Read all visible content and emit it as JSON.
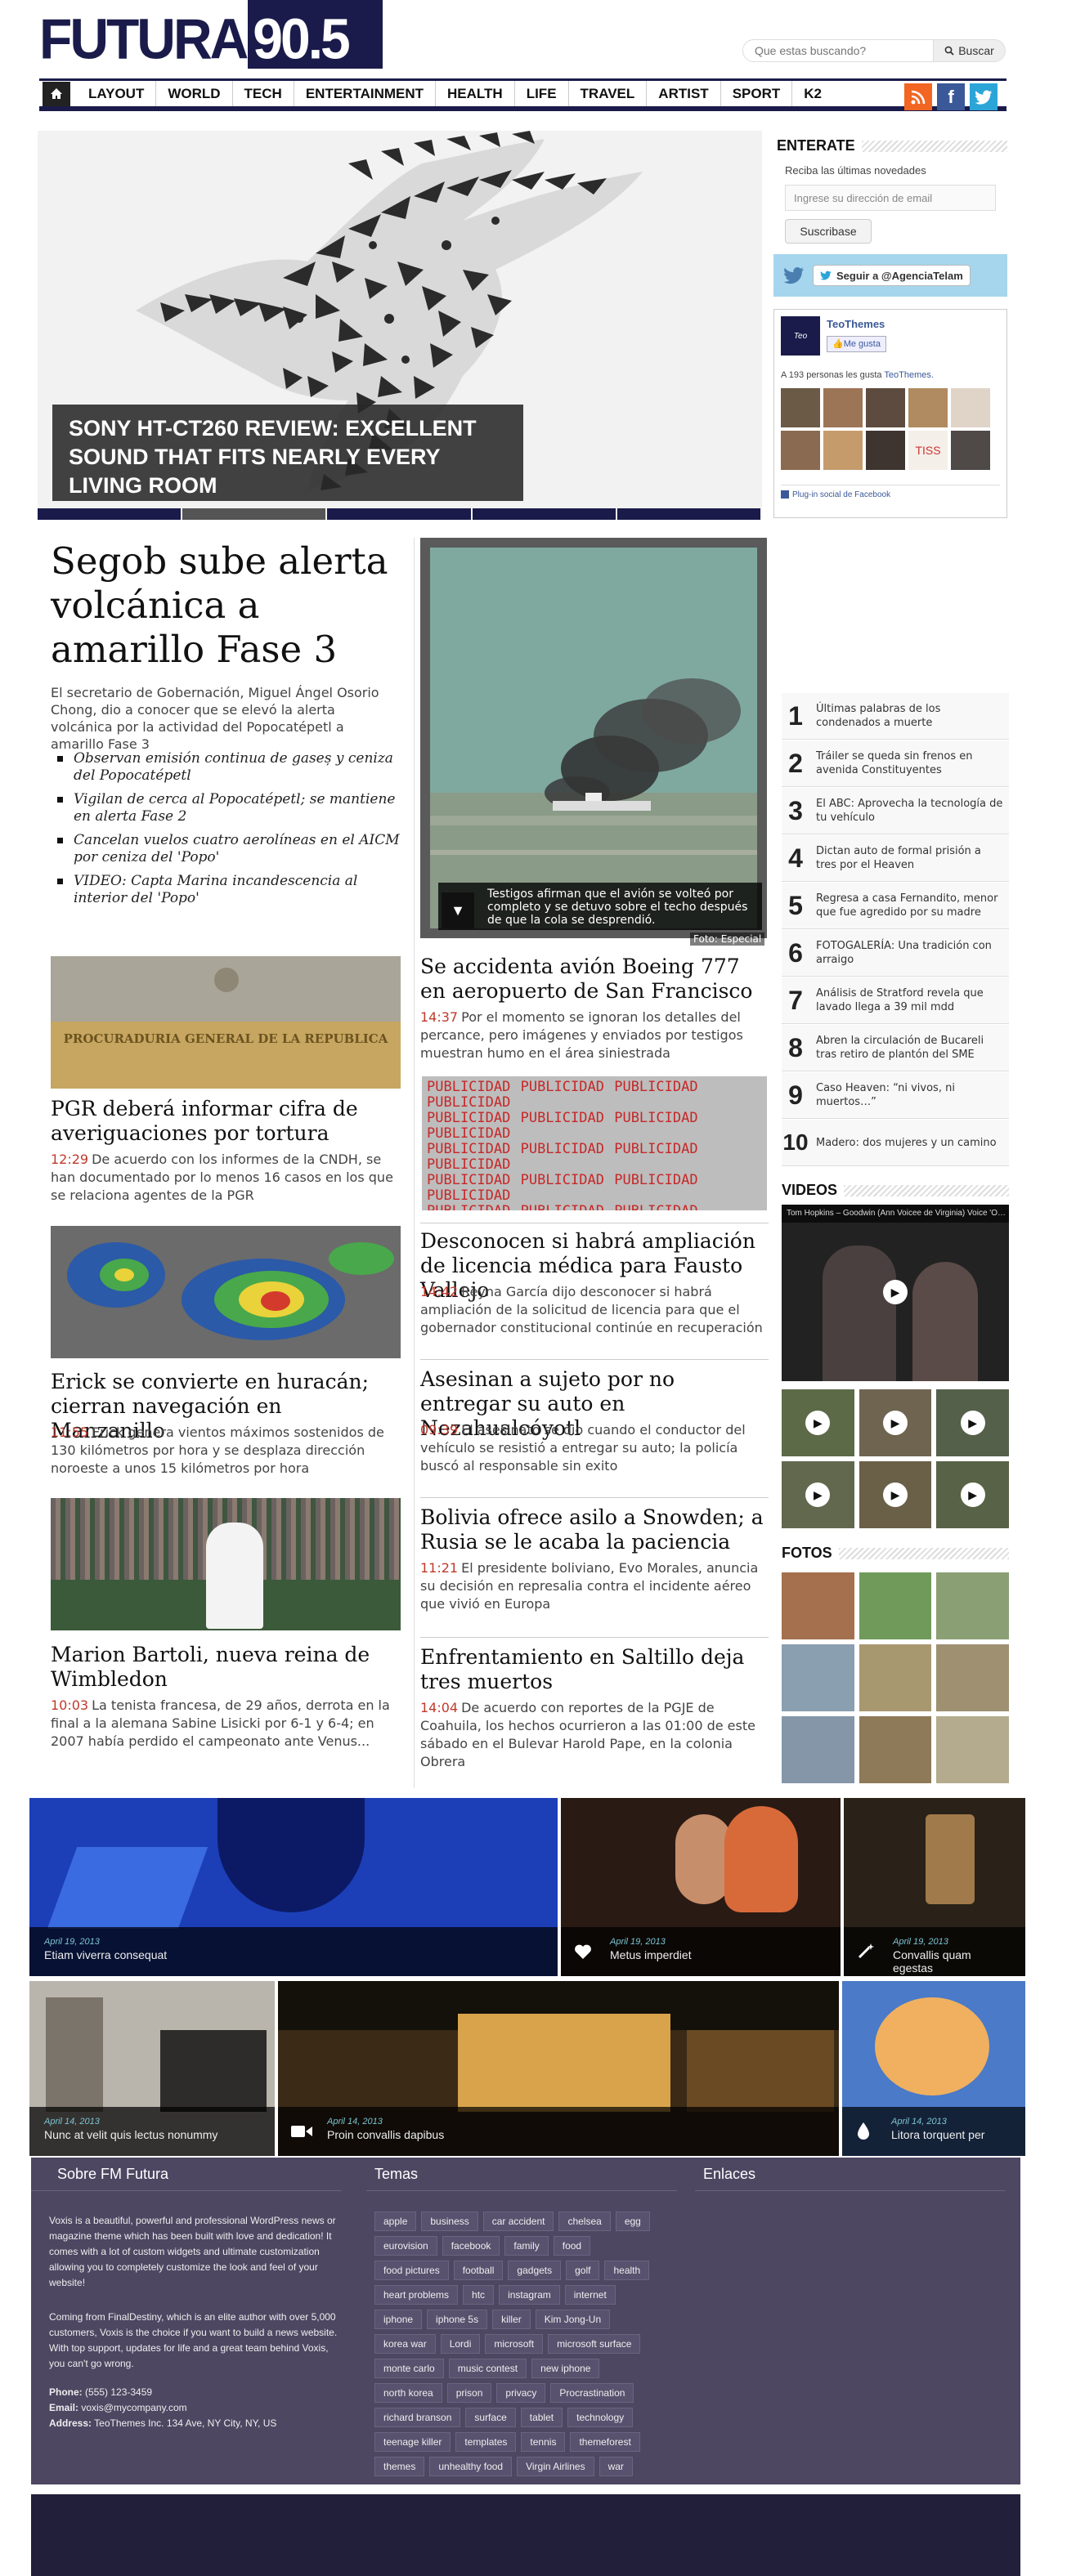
{
  "header": {
    "logo_left": "FUTURA",
    "logo_right": "FM 90.5",
    "search_placeholder": "Que estas buscando?",
    "search_button": "Buscar"
  },
  "nav": {
    "items": [
      "LAYOUT",
      "WORLD",
      "TECH",
      "ENTERTAINMENT",
      "HEALTH",
      "LIFE",
      "TRAVEL",
      "ARTIST",
      "SPORT",
      "K2"
    ]
  },
  "hero": {
    "caption": "SONY HT-CT260 REVIEW: EXCELLENT SOUND THAT FITS NEARLY EVERY LIVING ROOM"
  },
  "sidebar": {
    "newsletter_title": "ENTERATE",
    "newsletter_text": "Reciba las últimas novedades",
    "email_placeholder": "Ingrese su dirección de email",
    "subscribe_label": "Suscribase",
    "twitter_label": "Seguir a @AgenciaTelam",
    "fb_page": "TeoThemes",
    "fb_like": "Me gusta",
    "fb_count_text": "A 193 personas les gusta",
    "fb_count_link": "TeoThemes.",
    "fb_plugin": "Plug-in social de Facebook",
    "avatar_label": "TISS",
    "videos_title": "VIDEOS",
    "video_top_title": "Tom Hopkins – Goodwin (Ann Voicee de Virginia) Voice 'O…",
    "fotos_title": "FOTOS"
  },
  "main": {
    "headline": "Segob sube alerta volcánica a amarillo Fase 3",
    "lead": "El secretario de Gobernación, Miguel Ángel Osorio Chong, dio a conocer que se elevó la alerta volcánica por la actividad del Popocatépetl a amarillo Fase 3",
    "bullets": [
      "Observan emisión continua de gaseș y ceniza del Popocatépetl",
      "Vigilan de cerca al Popocatépetl; se mantiene en alerta Fase 2",
      "Cancelan vuelos cuatro aerolíneas en el AICM por ceniza del 'Popo'",
      "VIDEO: Capta Marina incandescencia al interior del 'Popo'"
    ],
    "photo_caption": "Testigos afirman que el avión se volteó por completo y se detuvo sobre el techo después de que la cola se desprendió.",
    "photo_credit": "Foto: Especial"
  },
  "left_stories": [
    {
      "title": "PGR deberá informar cifra de averiguaciones por tortura",
      "time": "12:29",
      "text": "De acuerdo con los informes de la CNDH, se han documentado por lo menos 16 casos en los que se relaciona agentes de la PGR"
    },
    {
      "title": "Erick se convierte en huracán; cierran navegación en Manzanillo",
      "time": "11:55",
      "text": "Erick genera vientos máximos sostenidos de 130 kilómetros por hora y se desplaza dirección noroeste a unos 15 kilómetros por hora"
    },
    {
      "title": "Marion Bartoli, nueva reina de Wimbledon",
      "time": "10:03",
      "text": "La tenista francesa, de 29 años, derrota en la final a la alemana Sabine Lisicki por 6-1 y 6-4; en 2007 había perdido el campeonato ante Venus..."
    }
  ],
  "pgr_building_text": "PROCURADURIA GENERAL DE LA REPUBLICA",
  "mid_stories": [
    {
      "title": "Se accidenta avión Boeing 777 en aeropuerto de San Francisco",
      "time": "14:37",
      "text": "Por el momento se ignoran los detalles del percance, pero imágenes y enviados por testigos muestran humo en el área siniestrada"
    },
    {
      "title": "Desconocen si habrá ampliación de licencia médica para Fausto Vallejo",
      "time": "14:42",
      "text": "Reyna García dijo desconocer si habrá ampliación de la solicitud de licencia para que el gobernador constitucional continúe en recuperación"
    },
    {
      "title": "Asesinan a sujeto por no entregar su auto en Nezahualcóyotl",
      "time": "09:39",
      "text": "El asesinato se dio cuando el conductor del vehículo se resistió a entregar su auto; la policía buscó al responsable sin exito"
    },
    {
      "title": "Bolivia ofrece asilo a Snowden; a Rusia se le acaba la paciencia",
      "time": "11:21",
      "text": "El presidente boliviano, Evo Morales, anuncia su decisión en represalia contra el incidente aéreo que vivió en Europa"
    },
    {
      "title": "Enfrentamiento en Saltillo deja tres muertos",
      "time": "14:04",
      "text": "De acuerdo con reportes de la PGJE de Coahuila, los hechos ocurrieron a las 01:00 de este sábado en el Bulevar Harold Pape, en la colonia Obrera"
    }
  ],
  "ad_word": "PUBLICIDAD",
  "ranking": [
    "Últimas palabras de los condenados a muerte",
    "Tráiler se queda sin frenos en avenida Constituyentes",
    "El ABC: Aprovecha la tecnología de tu vehículo",
    "Dictan auto de formal prisión a tres por el Heaven",
    "Regresa a casa Fernandito, menor que fue agredido por su madre",
    "FOTOGALERÍA: Una tradición con arraigo",
    "Análisis de Stratford revela que lavado llega a 39 mil mdd",
    "Abren la circulación de Bucareli tras retiro de plantón del SME",
    "Caso Heaven: “ni vivos, ni muertos…”",
    "Madero: dos mujeres y un camino"
  ],
  "ranking_numbers": [
    "1",
    "2",
    "3",
    "4",
    "5",
    "6",
    "7",
    "8",
    "9",
    "10"
  ],
  "gallery": [
    {
      "date": "April 19, 2013",
      "title": "Etiam viverra consequat"
    },
    {
      "date": "April 19, 2013",
      "title": "Metus imperdiet"
    },
    {
      "date": "April 19, 2013",
      "title": "Convallis quam egestas"
    },
    {
      "date": "April 14, 2013",
      "title": "Nunc at velit quis lectus nonummy"
    },
    {
      "date": "April 14, 2013",
      "title": "Proin convallis dapibus"
    },
    {
      "date": "April 14, 2013",
      "title": "Litora torquent per"
    }
  ],
  "footer": {
    "about_title": "Sobre FM Futura",
    "about_p1": "Voxis is a beautiful, powerful and professional WordPress news or magazine theme which has been built with love and dedication! It comes with a lot of custom widgets and ultimate customization allowing you to completely customize the look and feel of your website!",
    "about_p2": "Coming from FinalDestiny, which is an elite author with over 5,000 customers, Voxis is the choice if you want to build a news website. With top support, updates for life and a great team behind Voxis, you can't go wrong.",
    "phone_label": "Phone:",
    "phone": "(555) 123-3459",
    "email_label": "Email:",
    "email": "voxis@mycompany.com",
    "address_label": "Address:",
    "address": "TeoThemes Inc. 134 Ave, NY City, NY, US",
    "tags_title": "Temas",
    "links_title": "Enlaces",
    "tags": [
      "apple",
      "business",
      "car accident",
      "chelsea",
      "egg",
      "eurovision",
      "facebook",
      "family",
      "food",
      "food pictures",
      "football",
      "gadgets",
      "golf",
      "health",
      "heart problems",
      "htc",
      "instagram",
      "internet",
      "iphone",
      "iphone 5s",
      "killer",
      "Kim Jong-Un",
      "korea war",
      "Lordi",
      "microsoft",
      "microsoft surface",
      "monte carlo",
      "music contest",
      "new iphone",
      "north korea",
      "prison",
      "privacy",
      "Procrastination",
      "richard branson",
      "surface",
      "tablet",
      "technology",
      "teenage killer",
      "templates",
      "tennis",
      "themeforest",
      "themes",
      "unhealthy food",
      "Virgin Airlines",
      "war"
    ]
  },
  "colors": {
    "brand": "#1a1b4a",
    "time": "#c0392b",
    "footer": "#4d4762",
    "footer_bottom": "#221f3a",
    "twitter_box": "#a5d6ee"
  }
}
